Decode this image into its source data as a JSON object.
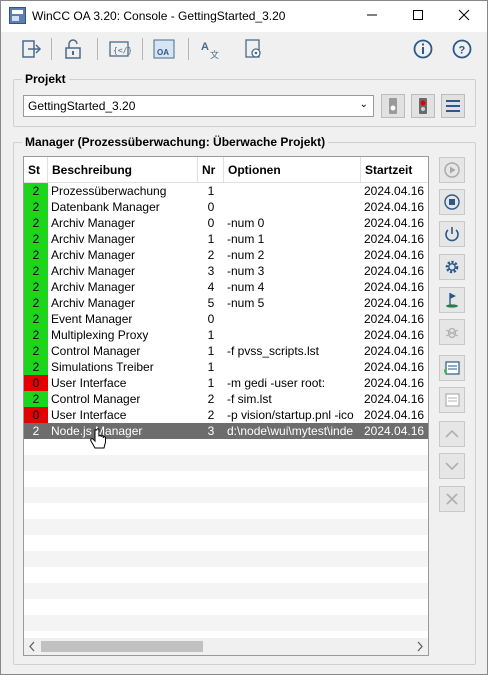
{
  "window": {
    "title": "WinCC OA 3.20: Console - GettingStarted_3.20"
  },
  "project": {
    "group_label": "Projekt",
    "selected": "GettingStarted_3.20"
  },
  "manager": {
    "group_label": "Manager  (Prozessüberwachung: Überwache Projekt)",
    "columns": [
      "St",
      "Beschreibung",
      "Nr",
      "Optionen",
      "Startzeit"
    ],
    "rows": [
      {
        "st": "2",
        "status": "green",
        "desc": "Prozessüberwachung",
        "nr": "1",
        "opt": "",
        "time": "2024.04.16"
      },
      {
        "st": "2",
        "status": "green",
        "desc": "Datenbank Manager",
        "nr": "0",
        "opt": "",
        "time": "2024.04.16"
      },
      {
        "st": "2",
        "status": "green",
        "desc": "Archiv Manager",
        "nr": "0",
        "opt": "-num 0",
        "time": "2024.04.16"
      },
      {
        "st": "2",
        "status": "green",
        "desc": "Archiv Manager",
        "nr": "1",
        "opt": "-num 1",
        "time": "2024.04.16"
      },
      {
        "st": "2",
        "status": "green",
        "desc": "Archiv Manager",
        "nr": "2",
        "opt": "-num 2",
        "time": "2024.04.16"
      },
      {
        "st": "2",
        "status": "green",
        "desc": "Archiv Manager",
        "nr": "3",
        "opt": "-num 3",
        "time": "2024.04.16"
      },
      {
        "st": "2",
        "status": "green",
        "desc": "Archiv Manager",
        "nr": "4",
        "opt": "-num 4",
        "time": "2024.04.16"
      },
      {
        "st": "2",
        "status": "green",
        "desc": "Archiv Manager",
        "nr": "5",
        "opt": "-num 5",
        "time": "2024.04.16"
      },
      {
        "st": "2",
        "status": "green",
        "desc": "Event Manager",
        "nr": "0",
        "opt": "",
        "time": "2024.04.16"
      },
      {
        "st": "2",
        "status": "green",
        "desc": "Multiplexing Proxy",
        "nr": "1",
        "opt": "",
        "time": "2024.04.16"
      },
      {
        "st": "2",
        "status": "green",
        "desc": "Control Manager",
        "nr": "1",
        "opt": "-f pvss_scripts.lst",
        "time": "2024.04.16"
      },
      {
        "st": "2",
        "status": "green",
        "desc": "Simulations Treiber",
        "nr": "1",
        "opt": "",
        "time": "2024.04.16"
      },
      {
        "st": "0",
        "status": "red",
        "desc": "User Interface",
        "nr": "1",
        "opt": "-m gedi -user root:",
        "time": "2024.04.16"
      },
      {
        "st": "2",
        "status": "green",
        "desc": "Control Manager",
        "nr": "2",
        "opt": "-f sim.lst",
        "time": "2024.04.16"
      },
      {
        "st": "0",
        "status": "red",
        "desc": "User Interface",
        "nr": "2",
        "opt": "-p vision/startup.pnl -ico",
        "time": "2024.04.16"
      },
      {
        "st": "2",
        "status": "selected",
        "desc": "Node.js Manager",
        "nr": "3",
        "opt": "d:\\node\\wui\\mytest\\inde",
        "time": "2024.04.16"
      }
    ]
  },
  "colors": {
    "green": "#1ed51e",
    "red": "#e40000",
    "selected": "#6d6d6d"
  },
  "icons": {
    "toolbar": [
      "exit-icon",
      "unlock-icon",
      "script-icon",
      "wincc-oa-icon",
      "translate-icon",
      "settings-doc-icon",
      "info-icon",
      "help-icon"
    ],
    "side": [
      "start-icon",
      "stop-icon",
      "power-icon",
      "gear-icon",
      "debug-flag-icon",
      "bug-icon",
      "insert-manager-icon",
      "remove-manager-icon",
      "move-up-icon",
      "move-down-icon",
      "delete-icon"
    ]
  }
}
